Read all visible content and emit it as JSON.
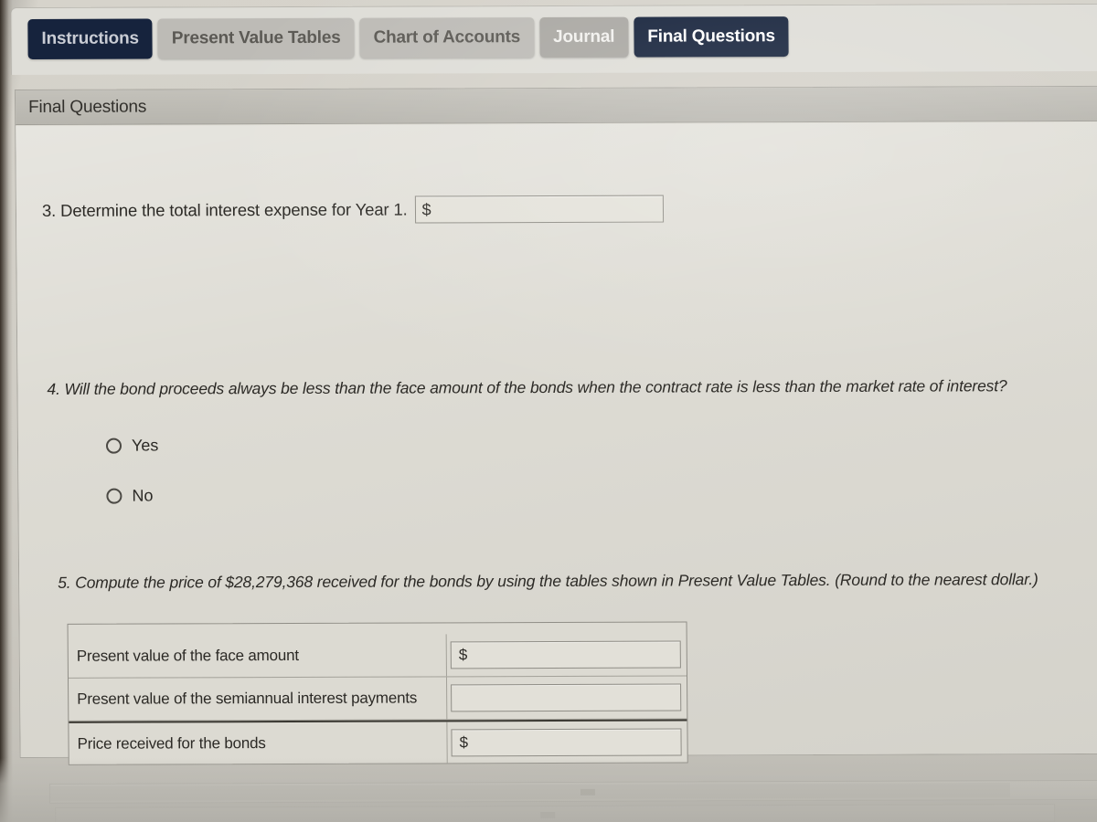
{
  "tabs": [
    {
      "label": "Instructions",
      "state": "dark"
    },
    {
      "label": "Present Value Tables",
      "state": "light"
    },
    {
      "label": "Chart of Accounts",
      "state": "light"
    },
    {
      "label": "Journal",
      "state": "journal"
    },
    {
      "label": "Final Questions",
      "state": "current"
    }
  ],
  "panel": {
    "header_title": "Final Questions"
  },
  "questions": {
    "q3": {
      "text": "3. Determine the total interest expense for Year 1.",
      "currency_symbol": "$",
      "value": "",
      "placeholder": ""
    },
    "q4": {
      "text": "4. Will the bond proceeds always be less than the face amount of the bonds when the contract rate is less than the market rate of interest?",
      "options": [
        {
          "label": "Yes",
          "selected": false
        },
        {
          "label": "No",
          "selected": false
        }
      ]
    },
    "q5": {
      "text": "5. Compute the price of $28,279,368 received for the bonds by using the tables shown in Present Value Tables. (Round to the nearest dollar.)",
      "amount": "$28,279,368",
      "rows": [
        {
          "label": "Present value of the face amount",
          "currency_symbol": "$",
          "value": "",
          "total_rule": false
        },
        {
          "label": "Present value of the semiannual interest payments",
          "currency_symbol": "",
          "value": "",
          "total_rule": false
        },
        {
          "label": "Price received for the bonds",
          "currency_symbol": "$",
          "value": "",
          "total_rule": true
        }
      ]
    }
  },
  "colors": {
    "tab_active": "#14213a",
    "tab_inactive": "#bdbbb6",
    "panel_bg": "#dcdad2",
    "header_bg": "#b7b5ae",
    "text": "#2c2a26",
    "border": "#8f8d86"
  }
}
